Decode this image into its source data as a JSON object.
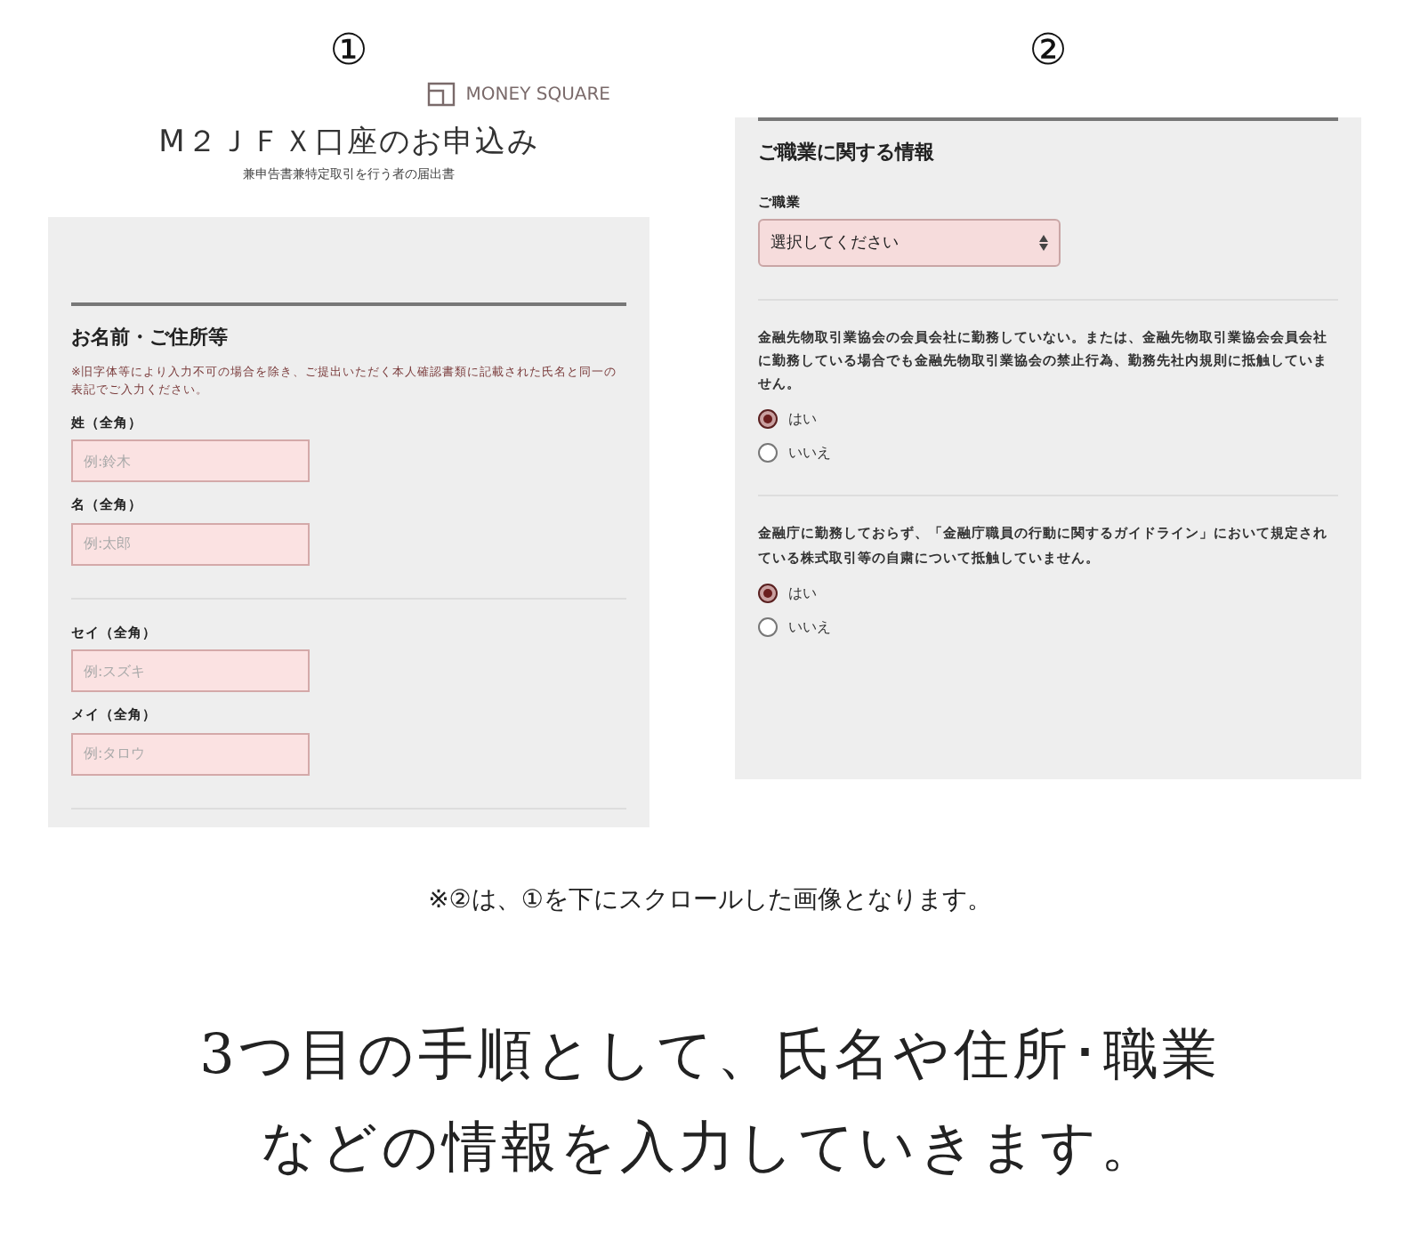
{
  "panels": [
    {
      "marker": "①",
      "logo": "MONEY SQUARE",
      "title": "M２ＪＦＸ口座のお申込み",
      "subtitle": "兼申告書兼特定取引を行う者の届出書",
      "section": "お名前・ご住所等",
      "note": "※旧字体等により入力不可の場合を除き、ご提出いただく本人確認書類に記載された氏名と同一の表記でご入力ください。",
      "groups": [
        {
          "fields": [
            {
              "label": "姓（全角）",
              "placeholder": "例:鈴木"
            },
            {
              "label": "名（全角）",
              "placeholder": "例:太郎"
            }
          ]
        },
        {
          "fields": [
            {
              "label": "セイ（全角）",
              "placeholder": "例:スズキ"
            },
            {
              "label": "メイ（全角）",
              "placeholder": "例:タロウ"
            }
          ]
        }
      ]
    },
    {
      "marker": "②",
      "section": "ご職業に関する情報",
      "select": {
        "label": "ご職業",
        "value": "選択してください"
      },
      "questions": [
        {
          "text": "金融先物取引業協会の会員会社に勤務していない。または、金融先物取引業協会会員会社に勤務している場合でも金融先物取引業協会の禁止行為、勤務先社内規則に抵触していません。",
          "options": [
            {
              "label": "はい",
              "selected": true
            },
            {
              "label": "いいえ",
              "selected": false
            }
          ]
        },
        {
          "text": "金融庁に勤務しておらず、「金融庁職員の行動に関するガイドライン」において規定されている株式取引等の自粛について抵触していません。",
          "options": [
            {
              "label": "はい",
              "selected": true
            },
            {
              "label": "いいえ",
              "selected": false
            }
          ]
        }
      ]
    }
  ],
  "caption": "※②は、①を下にスクロールした画像となります。",
  "headline": [
    "3つ目の手順として、氏名や住所･職業",
    "などの情報を入力していきます。"
  ]
}
